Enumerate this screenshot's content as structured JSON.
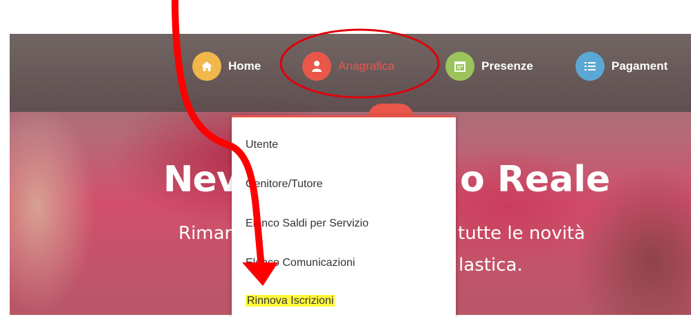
{
  "nav": {
    "items": [
      {
        "label": "Home",
        "icon": "home-icon",
        "color": "#f2b74a"
      },
      {
        "label": "Anagrafica",
        "icon": "user-icon",
        "color": "#e8574a"
      },
      {
        "label": "Presenze",
        "icon": "calendar-icon",
        "color": "#9cc35c"
      },
      {
        "label": "Pagament",
        "icon": "list-icon",
        "color": "#5ba8d4"
      }
    ]
  },
  "dropdown": {
    "items": [
      {
        "label": "Utente"
      },
      {
        "label": "Genitore/Tutore"
      },
      {
        "label": "Elenco Saldi per Servizio"
      },
      {
        "label": "Elenco Comunicazioni"
      },
      {
        "label": "Rinnova Iscrizioni"
      }
    ]
  },
  "hero": {
    "title_left": "Nev",
    "title_right": "o Reale",
    "sub_left_1": "Rimar",
    "sub_right_1": "tutte le novità",
    "sub_right_2": "lastica."
  },
  "colors": {
    "accent": "#e8574a",
    "annotation": "#ff0000",
    "highlight": "#fff73a"
  }
}
